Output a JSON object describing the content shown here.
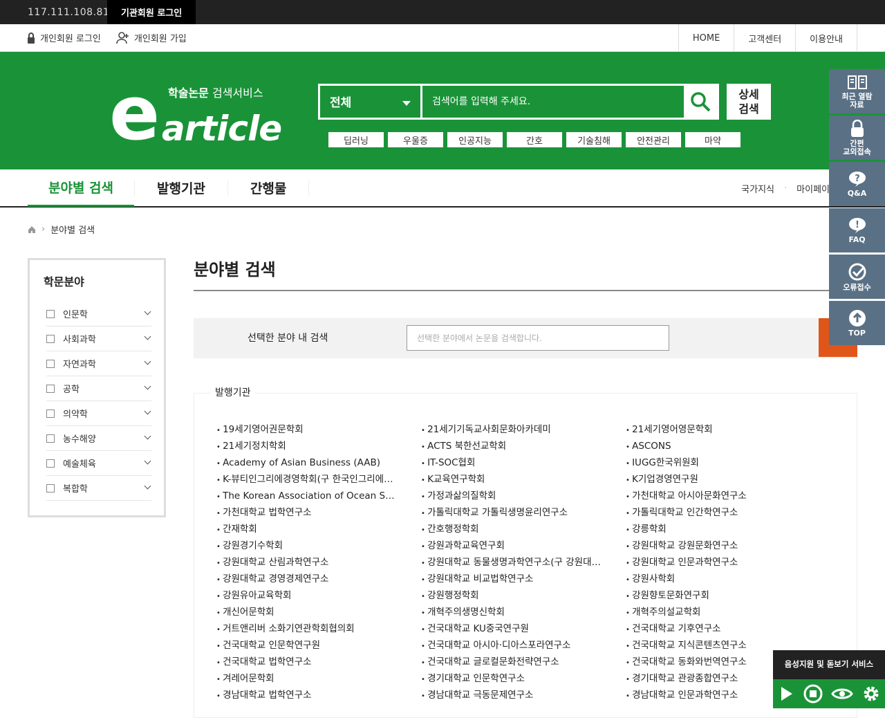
{
  "topbar": {
    "ip": "117.111.108.81",
    "inst_login": "기관회원 로그인"
  },
  "userbar": {
    "login": "개인회원 로그인",
    "join": "개인회원 가입",
    "links": [
      "HOME",
      "고객센터",
      "이용안내"
    ]
  },
  "header": {
    "logo_sub_bold": "학술논문",
    "logo_sub": " 검색서비스",
    "logo_e": "e",
    "logo_text": "article",
    "search_scope": "전체",
    "search_placeholder": "검색어를 입력해 주세요.",
    "detail_search": "상세\n검색",
    "keywords": [
      "딥러닝",
      "우울증",
      "인공지능",
      "간호",
      "기술침해",
      "안전관리",
      "마약"
    ]
  },
  "nav": {
    "tabs": [
      "분야별 검색",
      "발행기관",
      "간행물"
    ],
    "right_links": [
      "국가지식",
      "마이페이"
    ]
  },
  "breadcrumb": "분야별 검색",
  "sidebar": {
    "title": "학문분야",
    "items": [
      "인문학",
      "사회과학",
      "자연과학",
      "공학",
      "의약학",
      "농수해양",
      "예술체육",
      "복합학"
    ]
  },
  "main": {
    "title": "분야별 검색",
    "filter_label": "선택한 분야 내 검색",
    "filter_placeholder": "선택한 분야에서 논문을 검색합니다.",
    "pub_title": "발행기관",
    "publishers": [
      "19세기영어권문학회",
      "21세기기독교사회문화아카데미",
      "21세기영어영문학회",
      "21세기정치학회",
      "ACTS 북한선교학회",
      "ASCONS",
      "Academy of Asian Business (AAB)",
      "IT-SOC협회",
      "IUGG한국위원회",
      "K-뷰티인그리에경영학회(구 한국인그리에경영학회)",
      "K교육연구학회",
      "K기업경영연구원",
      "The Korean Association of Ocean Science and Technology Societies",
      "가정과삶의질학회",
      "가천대학교 아시아문화연구소",
      "가천대학교 법학연구소",
      "가톨릭대학교 가톨릭생명윤리연구소",
      "가톨릭대학교 인간학연구소",
      "간재학회",
      "간호행정학회",
      "강릉학회",
      "강원경기수학회",
      "강원과학교육연구회",
      "강원대학교 강원문화연구소",
      "강원대학교 산림과학연구소",
      "강원대학교 동물생명과학연구소(구 강원대학교 동물자원공동연구소)",
      "강원대학교 인문과학연구소",
      "강원대학교 경영경제연구소",
      "강원대학교 비교법학연구소",
      "강원사학회",
      "강원유아교육학회",
      "강원행정학회",
      "강원향토문화연구회",
      "개신어문학회",
      "개혁주의생명신학회",
      "개혁주의설교학회",
      "거트앤리버 소화기연관학회협의회",
      "건국대학교 KU중국연구원",
      "건국대학교 기후연구소",
      "건국대학교 인문학연구원",
      "건국대학교 아시아·디아스포라연구소",
      "건국대학교 지식콘텐츠연구소",
      "건국대학교 법학연구소",
      "건국대학교 글로컬문화전략연구소",
      "건국대학교 동화와번역연구소",
      "겨레어문학회",
      "경기대학교 인문학연구소",
      "경기대학교 관광종합연구소",
      "경남대학교 법학연구소",
      "경남대학교 극동문제연구소",
      "경남대학교 인문과학연구소"
    ]
  },
  "floating": [
    "최근 열람\n자료",
    "간편\n교외접속",
    "Q&A",
    "FAQ",
    "오류접수",
    "TOP"
  ],
  "voice": {
    "title": "음성지원 및 돋보기 서비스"
  },
  "colors": {
    "brand_green": "#1a9338",
    "float_gray": "#5a7085",
    "accent_orange": "#e0561a"
  }
}
